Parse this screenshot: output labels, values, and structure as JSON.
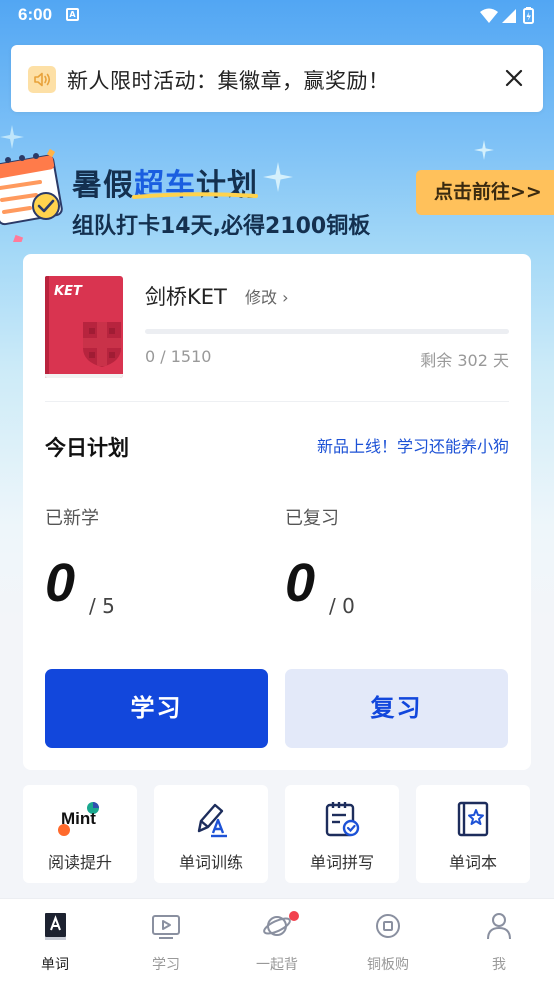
{
  "status_bar": {
    "time": "6:00",
    "app_badge": "A"
  },
  "notice": {
    "text": "新人限时活动：集徽章，赢奖励！"
  },
  "banner": {
    "title_pre": "暑假",
    "title_hl": "超车",
    "title_post": "计划",
    "subtitle": "组队打卡14天,必得2100铜板",
    "cta": "点击前往>>"
  },
  "course": {
    "book_label": "KET",
    "name": "剑桥KET",
    "edit": "修改 ›",
    "progress_text": "0 / 1510",
    "progress_fraction": 0,
    "remaining": "剩余 302 天"
  },
  "plan": {
    "title": "今日计划",
    "promo": "新品上线！学习还能养小狗",
    "new_label": "已新学",
    "new_value": "0",
    "new_total": "/ 5",
    "review_label": "已复习",
    "review_value": "0",
    "review_total": "/ 0",
    "learn_button": "学习",
    "review_button": "复习"
  },
  "tools": [
    {
      "label": "阅读提升",
      "icon": "mint-logo-icon",
      "logo_text": "Mint"
    },
    {
      "label": "单词训练",
      "icon": "pen-a-icon"
    },
    {
      "label": "单词拼写",
      "icon": "calendar-check-icon"
    },
    {
      "label": "单词本",
      "icon": "star-book-icon"
    }
  ],
  "tabs": [
    {
      "label": "单词",
      "icon": "word-book-icon",
      "active": true
    },
    {
      "label": "学习",
      "icon": "play-screen-icon"
    },
    {
      "label": "一起背",
      "icon": "planet-icon",
      "badge": true
    },
    {
      "label": "铜板购",
      "icon": "coin-icon"
    },
    {
      "label": "我",
      "icon": "profile-icon"
    }
  ],
  "colors": {
    "primary": "#1247dc",
    "accent": "#ffc15b",
    "badge": "#f2414e"
  }
}
